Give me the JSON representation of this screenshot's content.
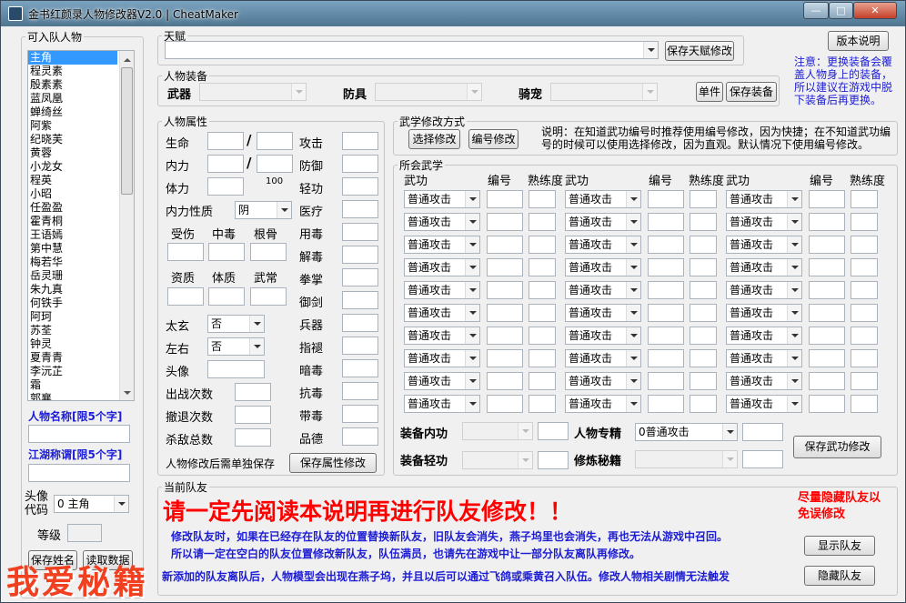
{
  "window": {
    "title": "金书红颜录人物修改器V2.0 | CheatMaker",
    "min": "—",
    "max": "□",
    "close": "✕"
  },
  "left": {
    "group_label": "可入队人物",
    "characters": [
      "主角",
      "程灵素",
      "殷素素",
      "蓝凤凰",
      "蝉绮丝",
      "阿紫",
      "纪晓芙",
      "黄蓉",
      "小龙女",
      "程英",
      "小昭",
      "任盈盈",
      "霍青桐",
      "王语嫣",
      "第中慧",
      "梅若华",
      "岳灵珊",
      "朱九真",
      "何铁手",
      "阿珂",
      "苏荃",
      "钟灵",
      "夏青青",
      "李沅芷",
      "霜",
      "郭襄"
    ],
    "name_label": "人物名称[限5个字]",
    "nick_label": "江湖称谓[限5个字]",
    "avatar_label": "头像代码",
    "avatar_value": "0 主角",
    "level_label": "等级",
    "save_btn": "保存姓名",
    "read_btn": "读取数据"
  },
  "talent": {
    "label": "天赋",
    "save_btn": "保存天赋修改"
  },
  "version_btn": "版本说明",
  "equip": {
    "label": "人物装备",
    "weapon": "武器",
    "armor": "防具",
    "mount": "骑宠",
    "single_btn": "单件",
    "save_btn": "保存装备"
  },
  "note": "注意：更换装备会覆盖人物身上的装备，所以建议在游戏中脱下装备后再更换。",
  "attr": {
    "label": "人物属性",
    "life": "生命",
    "inner": "内力",
    "stamina": "体力",
    "stamina_max": "100",
    "inner_type": "内力性质",
    "inner_type_val": "阴",
    "injury": "受伤",
    "poison": "中毒",
    "bone": "根骨",
    "aptitude": "资质",
    "physique": "体质",
    "martial": "武常",
    "taixuan": "太玄",
    "taixuan_val": "否",
    "zuoyou": "左右",
    "zuoyou_val": "否",
    "avatar": "头像",
    "battles": "出战次数",
    "retreats": "撤退次数",
    "kills": "杀敌总数",
    "attack": "攻击",
    "defense": "防御",
    "agility": "轻功",
    "medic": "医疗",
    "use_poison": "用毒",
    "detox": "解毒",
    "fist": "拳掌",
    "sword": "御剑",
    "weapon": "兵器",
    "finger": "指褪",
    "hidden": "暗毒",
    "resist": "抗毒",
    "carry_poison": "带毒",
    "virtue": "品德",
    "hint": "人物修改后需单独保存",
    "save_btn": "保存属性修改",
    "slash": "/"
  },
  "method": {
    "label": "武学修改方式",
    "select_btn": "选择修改",
    "number_btn": "编号修改",
    "desc": "说明：在知道武功编号时推荐使用编号修改，因为快捷；在不知道武功编号的时候可以使用选择修改，因为直观。默认情况下使用编号修改。"
  },
  "skills": {
    "label": "所会武学",
    "col_skill": "武功",
    "col_num": "编号",
    "col_prof": "熟练度",
    "default_skill": "普通攻击",
    "equip_inner": "装备内功",
    "equip_light": "装备轻功",
    "specialty": "人物专精",
    "specialty_val": "0普通攻击",
    "practice": "修炼秘籍",
    "save_btn": "保存武功修改"
  },
  "team": {
    "label": "当前队友",
    "headline": "请一定先阅读本说明再进行队友修改！！",
    "side_note": "尽量隐藏队友以免误修改",
    "line1": "修改队友时，如果在已经存在队友的位置替换新队友，旧队友会消失，燕子坞里也会消失，再也无法从游戏中召回。",
    "line2": "所以请一定在空白的队友位置修改新队友，队伍满员，也请先在游戏中让一部分队友离队再修改。",
    "line3": "新添加的队友离队后，人物模型会出现在燕子坞，并且以后可以通过飞鸽或乘黄召入队伍。修改人物相关剧情无法触发",
    "show_btn": "显示队友",
    "hide_btn": "隐藏队友"
  },
  "watermark": "我爱秘籍",
  "colors": {
    "accent_blue": "#1d1dd4",
    "warning_red": "#ff0000",
    "selection": "#3399ff"
  }
}
